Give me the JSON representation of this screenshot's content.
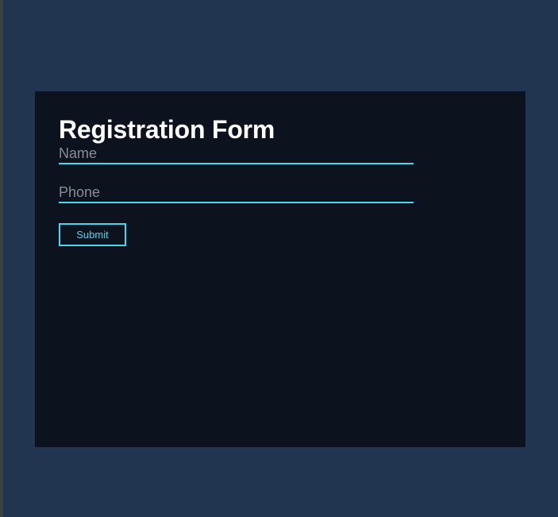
{
  "form": {
    "title": "Registration Form",
    "fields": [
      {
        "value": "",
        "placeholder": "Name"
      },
      {
        "value": "",
        "placeholder": "Phone"
      }
    ],
    "submit_label": "Submit"
  },
  "colors": {
    "page_background": "#213550",
    "panel_background": "#0c121e",
    "accent": "#48d6ee",
    "title_text": "#ffffff",
    "placeholder_text": "#8a8d92"
  }
}
